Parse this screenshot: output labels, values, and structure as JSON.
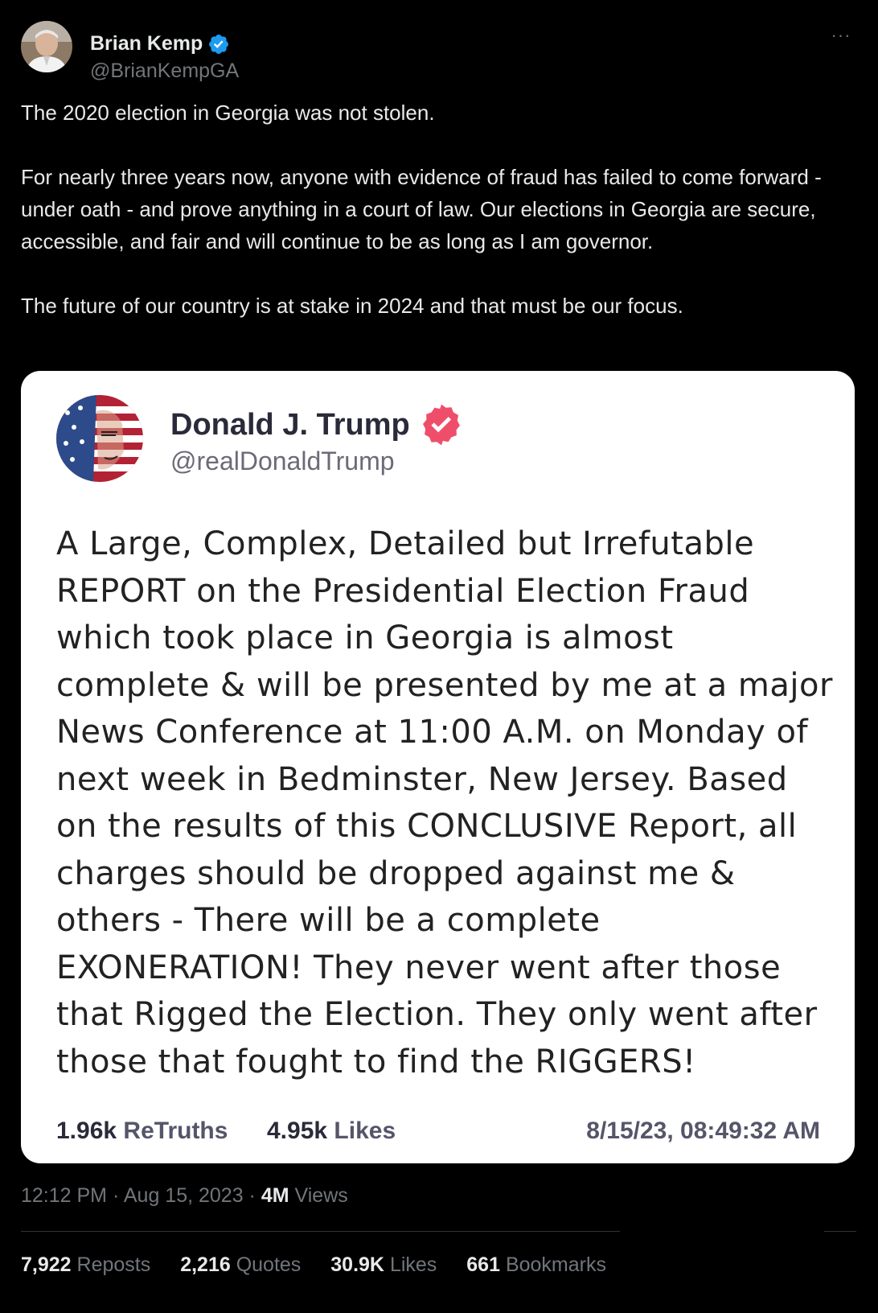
{
  "author": {
    "name": "Brian Kemp",
    "handle": "@BrianKempGA"
  },
  "more_label": "···",
  "tweet": {
    "paragraphs": [
      "The 2020 election in Georgia was not stolen.",
      "For nearly three years now, anyone with evidence of fraud has failed to come forward - under oath - and prove anything in a court of law. Our elections in Georgia are secure, accessible, and fair and will continue to be as long as I am governor.",
      "The future of our country is at stake in 2024 and that must be our focus."
    ]
  },
  "quote": {
    "name": "Donald J. Trump",
    "handle": "@realDonaldTrump",
    "lines": [
      "A Large, Complex, Detailed but Irrefutable",
      "REPORT on the Presidential Election Fraud",
      "which took place in Georgia is almost",
      "complete & will be presented by me at a major",
      "News Conference at 11:00 A.M. on Monday of",
      "next week in Bedminster, New Jersey. Based",
      "on the results of this CONCLUSIVE Report, all",
      "charges should be dropped against me &",
      "others - There will be a complete",
      "EXONERATION! They never went after those",
      "that Rigged the Election. They only went after",
      "those that fought to find the RIGGERS!"
    ],
    "retruths_count": "1.96k",
    "retruths_label": "ReTruths",
    "likes_count": "4.95k",
    "likes_label": "Likes",
    "timestamp": "8/15/23, 08:49:32 AM"
  },
  "meta": {
    "time": "12:12 PM",
    "sep1": " · ",
    "date": "Aug 15, 2023",
    "sep2": " · ",
    "views_count": "4M",
    "views_label": "Views"
  },
  "engagement": {
    "reposts_count": "7,922",
    "reposts_label": "Reposts",
    "quotes_count": "2,216",
    "quotes_label": "Quotes",
    "likes_count": "30.9K",
    "likes_label": "Likes",
    "bookmarks_count": "661",
    "bookmarks_label": "Bookmarks"
  },
  "colors": {
    "background": "#000000",
    "text_primary": "#e7e9ea",
    "text_secondary": "#71767b",
    "verified_blue": "#1d9bf0",
    "truth_badge": "#ef4e6a",
    "card_background": "#ffffff"
  },
  "icons": {
    "verified": "verified-badge-icon",
    "truth_verified": "truth-verified-badge-icon",
    "more": "more-dots-icon"
  }
}
